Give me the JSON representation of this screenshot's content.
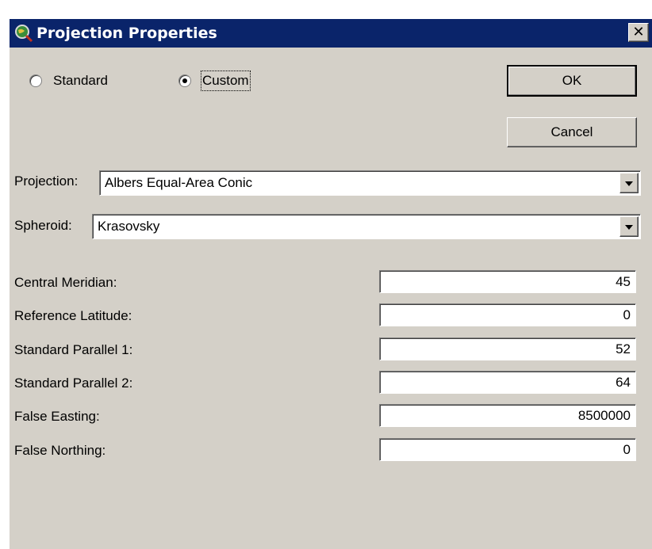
{
  "window": {
    "title": "Projection Properties",
    "close_label": "✕"
  },
  "mode": {
    "standard_label": "Standard",
    "custom_label": "Custom",
    "selected": "Custom"
  },
  "buttons": {
    "ok_label": "OK",
    "cancel_label": "Cancel"
  },
  "projection": {
    "label": "Projection:",
    "value": "Albers Equal-Area Conic"
  },
  "spheroid": {
    "label": "Spheroid:",
    "value": "Krasovsky"
  },
  "params": [
    {
      "label": "Central Meridian:",
      "value": "45"
    },
    {
      "label": "Reference Latitude:",
      "value": "0"
    },
    {
      "label": "Standard Parallel 1:",
      "value": "52"
    },
    {
      "label": "Standard Parallel 2:",
      "value": "64"
    },
    {
      "label": "False Easting:",
      "value": "8500000"
    },
    {
      "label": "False Northing:",
      "value": "0"
    }
  ],
  "colors": {
    "titlebar": "#0a246a",
    "dialog_bg": "#d4d0c8"
  },
  "icons": {
    "app": "globe-magnifier-icon",
    "close": "close-icon",
    "dropdown": "chevron-down-icon"
  }
}
